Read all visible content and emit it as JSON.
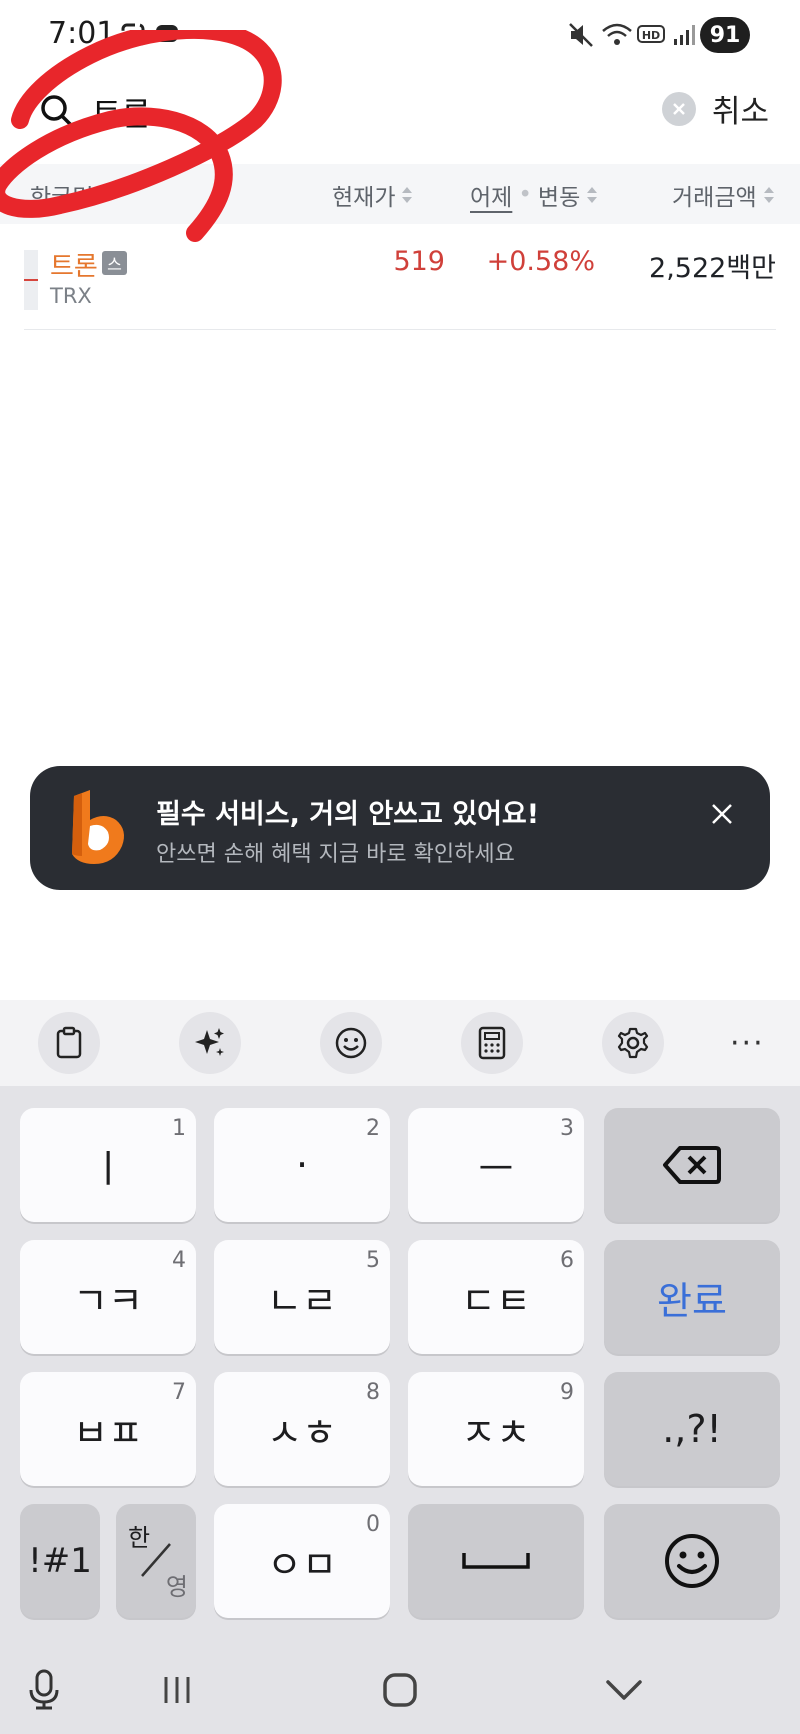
{
  "status_bar": {
    "time": "7:01",
    "battery": "91",
    "icons": [
      "screenshot-icon",
      "message-icon",
      "mute-icon",
      "wifi-icon",
      "hd-icon",
      "signal-icon"
    ]
  },
  "search": {
    "query": "트론",
    "clear_icon": "clear-icon",
    "cancel_label": "취소"
  },
  "table_header": {
    "name_label": "한글명",
    "price_label": "현재가",
    "change_basis": "어제",
    "change_label": "변동",
    "volume_label": "거래금액"
  },
  "results": [
    {
      "name": "트론",
      "badge": "스",
      "ticker": "TRX",
      "price": "519",
      "change": "+0.58%",
      "volume": "2,522백만"
    }
  ],
  "toast": {
    "title": "필수 서비스, 거의 안쓰고 있어요!",
    "subtitle": "안쓰면 손해 혜택 지금 바로 확인하세요"
  },
  "keyboard": {
    "toolbar": [
      "clipboard-icon",
      "sparkle-icon",
      "emoji-icon",
      "keypad-icon",
      "settings-icon",
      "more-icon"
    ],
    "more_label": "···",
    "rows": [
      [
        {
          "label": "ㅣ",
          "num": "1"
        },
        {
          "label": "·",
          "num": "2"
        },
        {
          "label": "ㅡ",
          "num": "3"
        },
        {
          "label": "⌫",
          "num": ""
        }
      ],
      [
        {
          "label": "ㄱㅋ",
          "num": "4"
        },
        {
          "label": "ㄴㄹ",
          "num": "5"
        },
        {
          "label": "ㄷㅌ",
          "num": "6"
        },
        {
          "label": "완료",
          "num": ""
        }
      ],
      [
        {
          "label": "ㅂㅍ",
          "num": "7"
        },
        {
          "label": "ㅅㅎ",
          "num": "8"
        },
        {
          "label": "ㅈㅊ",
          "num": "9"
        },
        {
          "label": ".,?!",
          "num": ""
        }
      ],
      [
        {
          "label": "!#1",
          "num": ""
        },
        {
          "label": "한/영",
          "num": ""
        },
        {
          "label": "ㅇㅁ",
          "num": "0"
        },
        {
          "label": "space",
          "num": ""
        },
        {
          "label": "☺",
          "num": ""
        }
      ]
    ],
    "symbols_label": "!#1",
    "lang_top": "한",
    "lang_bottom": "영",
    "punct_label": ".,?!",
    "done_label": "완료"
  },
  "navbar": [
    "mic-icon",
    "recents-icon",
    "home-icon",
    "back-chevron-icon"
  ],
  "colors": {
    "up_red": "#d0403a",
    "name_orange": "#e5772e",
    "toast_bg": "#2a2d33",
    "annotation_red": "#e8262b",
    "done_blue": "#3a6fd8"
  }
}
